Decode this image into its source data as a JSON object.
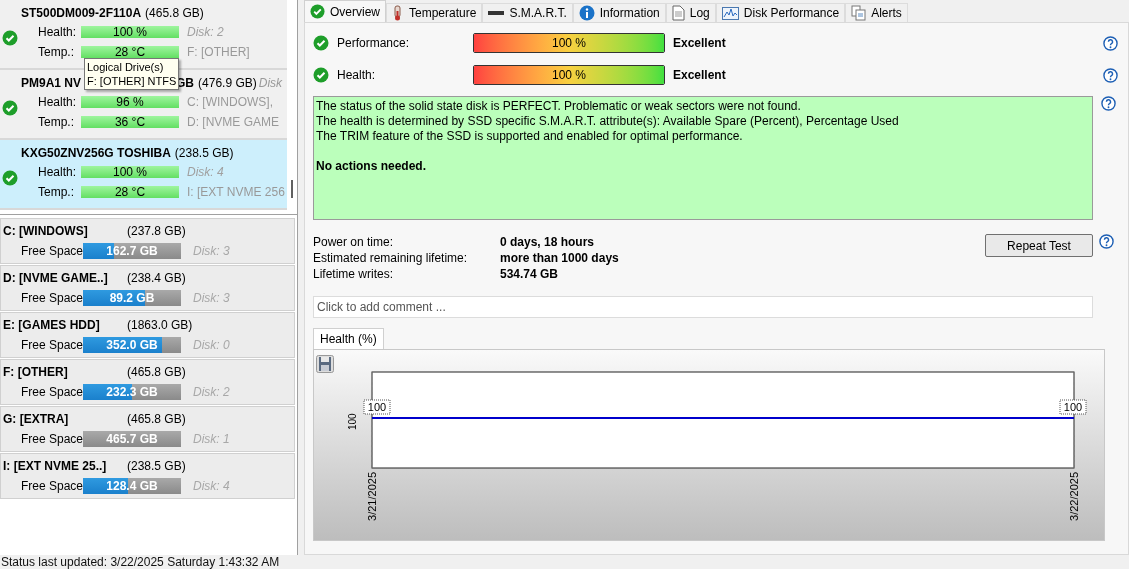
{
  "disks": [
    {
      "name": "ST500DM009-2F110A",
      "size": "(465.8 GB)",
      "health_label": "Health:",
      "health": "100 %",
      "temp_label": "Temp.:",
      "temp": "28 °C",
      "info1": "Disk: 2",
      "info2": "F: [OTHER]",
      "selected": false,
      "ok": true
    },
    {
      "name": "PM9A1 NV",
      "name_end": "GB",
      "size": "(476.9 GB)",
      "size_tail": "Disk",
      "health_label": "Health:",
      "health": "96 %",
      "temp_label": "Temp.:",
      "temp": "36 °C",
      "info1": "C: [WINDOWS],",
      "info2": "D: [NVME GAME",
      "selected": false,
      "ok": true
    },
    {
      "name": "KXG50ZNV256G TOSHIBA",
      "size": "(238.5 GB)",
      "health_label": "Health:",
      "health": "100 %",
      "temp_label": "Temp.:",
      "temp": "28 °C",
      "info1": "Disk: 4",
      "info2": "I: [EXT NVME 256",
      "selected": true,
      "ok": true
    }
  ],
  "tooltip": {
    "title": "Logical Drive(s)",
    "text": "F: [OTHER] NTFS"
  },
  "partitions": [
    {
      "name": "C: [WINDOWS]",
      "size": "(237.8 GB)",
      "label": "Free Space",
      "free": "162.7 GB",
      "level": 0.32,
      "disk": "Disk: 3"
    },
    {
      "name": "D: [NVME GAME..]",
      "size": "(238.4 GB)",
      "label": "Free Space",
      "free": "89.2 GB",
      "level": 0.63,
      "disk": "Disk: 3"
    },
    {
      "name": "E: [GAMES HDD]",
      "size": "(1863.0 GB)",
      "label": "Free Space",
      "free": "352.0 GB",
      "level": 0.81,
      "disk": "Disk: 0"
    },
    {
      "name": "F: [OTHER]",
      "size": "(465.8 GB)",
      "label": "Free Space",
      "free": "232.3 GB",
      "level": 0.5,
      "disk": "Disk: 2"
    },
    {
      "name": "G: [EXTRA]",
      "size": "(465.8 GB)",
      "label": "Free Space",
      "free": "465.7 GB",
      "level": 0,
      "disk": "Disk: 1"
    },
    {
      "name": "I: [EXT NVME 25..]",
      "size": "(238.5 GB)",
      "label": "Free Space",
      "free": "128.4 GB",
      "level": 0.46,
      "disk": "Disk: 4"
    }
  ],
  "status_bar": "Status last updated: 3/22/2025 Saturday 1:43:32 AM",
  "tabs": [
    {
      "label": "Overview",
      "selected": true
    },
    {
      "label": "Temperature",
      "selected": false
    },
    {
      "label": "S.M.A.R.T.",
      "selected": false
    },
    {
      "label": "Information",
      "selected": false
    },
    {
      "label": "Log",
      "selected": false
    },
    {
      "label": "Disk Performance",
      "selected": false
    },
    {
      "label": "Alerts",
      "selected": false
    }
  ],
  "ratings": [
    {
      "label": "Performance:",
      "value": "100 %",
      "level": 1,
      "verdict": "Excellent"
    },
    {
      "label": "Health:",
      "value": "100 %",
      "level": 1,
      "verdict": "Excellent"
    }
  ],
  "status_message": {
    "lines": [
      "The status of the solid state disk is PERFECT. Problematic or weak sectors were not found.",
      "The health is determined by SSD specific S.M.A.R.T. attribute(s):  Available Spare (Percent), Percentage Used",
      "The TRIM feature of the SSD is supported and enabled for optimal performance."
    ],
    "conclusion": "No actions needed."
  },
  "stats": [
    {
      "label": "Power on time:",
      "value": "0 days, 18 hours"
    },
    {
      "label": "Estimated remaining lifetime:",
      "value": "more than 1000 days"
    },
    {
      "label": "Lifetime writes:",
      "value": "534.74 GB"
    }
  ],
  "repeat_button": "Repeat Test",
  "comment": {
    "placeholder": "Click to add comment ..."
  },
  "chart_tab": {
    "label": "Health (%)"
  },
  "chart": {
    "kind": "line",
    "y_tick": "100",
    "point_labels": [
      "100",
      "100"
    ],
    "x_labels": [
      "3/21/2025",
      "3/22/2025"
    ]
  }
}
